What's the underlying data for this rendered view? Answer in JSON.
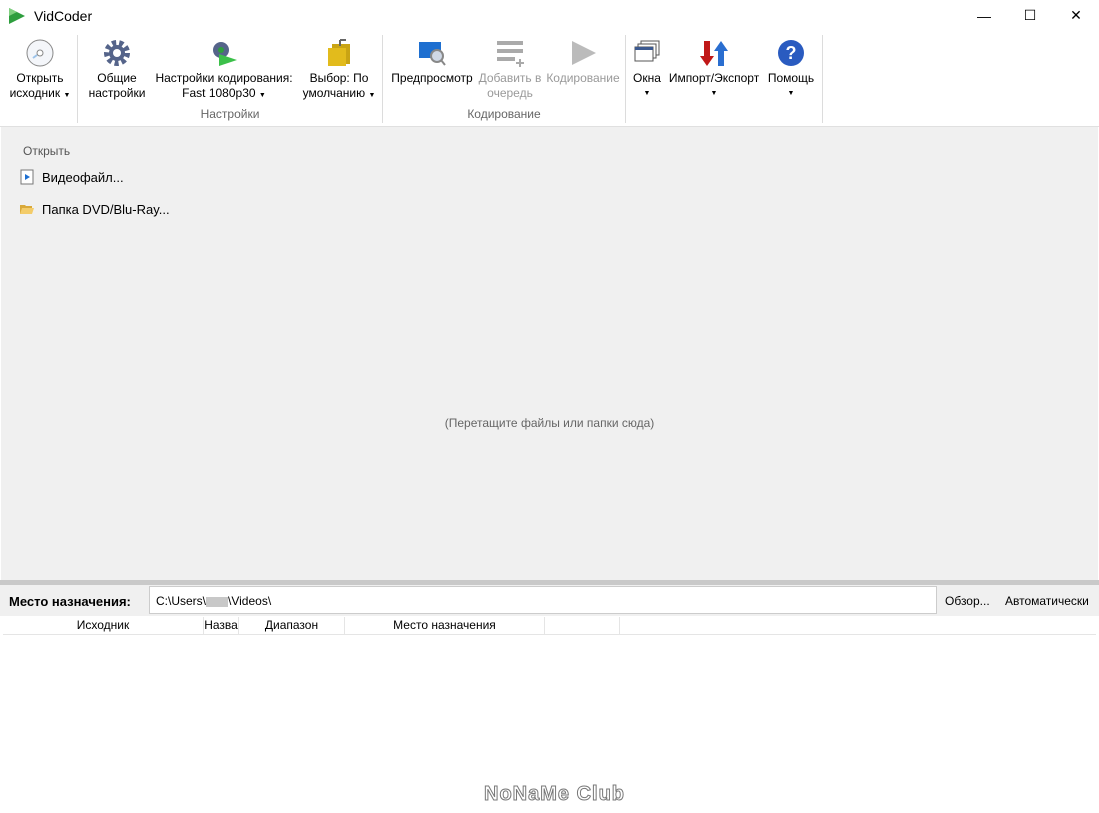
{
  "window": {
    "title": "VidCoder",
    "minimize": "—",
    "maximize": "☐",
    "close": "✕"
  },
  "ribbon": {
    "groups": [
      {
        "label": ""
      },
      {
        "label": "Настройки"
      },
      {
        "label": "Кодирование"
      },
      {
        "label": ""
      }
    ],
    "open_source": {
      "l1": "Открыть",
      "l2": "исходник"
    },
    "general": {
      "l1": "Общие",
      "l2": "настройки"
    },
    "encoding_settings": {
      "l1": "Настройки кодирования:",
      "l2": "Fast 1080p30"
    },
    "picker": {
      "l1": "Выбор: По",
      "l2": "умолчанию"
    },
    "preview": {
      "l1": "Предпросмотр"
    },
    "add_queue": {
      "l1": "Добавить в",
      "l2": "очередь"
    },
    "encode": {
      "l1": "Кодирование"
    },
    "windows": {
      "l1": "Окна"
    },
    "import_export": {
      "l1": "Импорт/Экспорт"
    },
    "help": {
      "l1": "Помощь"
    },
    "dropdown_arrow": "▼"
  },
  "main": {
    "open_heading": "Открыть",
    "video_file": "Видеофайл...",
    "dvd_folder": "Папка DVD/Blu-Ray...",
    "drop_hint": "(Перетащите файлы или папки сюда)"
  },
  "destination": {
    "label": "Место назначения:",
    "path_prefix": "C:\\Users\\",
    "path_suffix": "\\Videos\\",
    "browse": "Обзор...",
    "auto": "Автоматически"
  },
  "queue": {
    "columns": [
      "Исходник",
      "Назва",
      "Диапазон",
      "Место назначения",
      "",
      ""
    ]
  },
  "watermark": "NoNaMe Club"
}
